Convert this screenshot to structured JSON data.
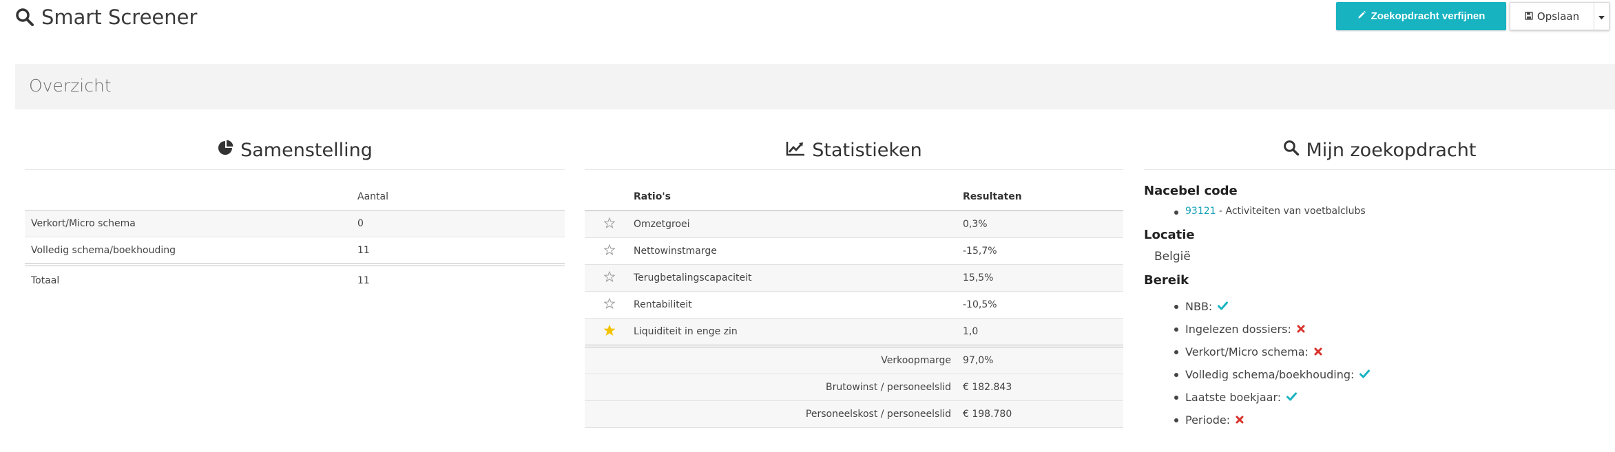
{
  "header": {
    "title": "Smart Screener",
    "refine_label": "Zoekopdracht verfijnen",
    "save_label": "Opslaan"
  },
  "overview": {
    "title": "Overzicht"
  },
  "composition": {
    "title": "Samenstelling",
    "column_header": "Aantal",
    "rows": [
      {
        "label": "Verkort/Micro schema",
        "value": "0"
      },
      {
        "label": "Volledig schema/boekhouding",
        "value": "11"
      }
    ],
    "total": {
      "label": "Totaal",
      "value": "11"
    }
  },
  "statistics": {
    "title": "Statistieken",
    "headers": {
      "ratios": "Ratio's",
      "results": "Resultaten"
    },
    "ratios": [
      {
        "label": "Omzetgroei",
        "value": "0,3%",
        "starred": false
      },
      {
        "label": "Nettowinstmarge",
        "value": "-15,7%",
        "starred": false
      },
      {
        "label": "Terugbetalingscapaciteit",
        "value": "15,5%",
        "starred": false
      },
      {
        "label": "Rentabiliteit",
        "value": "-10,5%",
        "starred": false
      },
      {
        "label": "Liquiditeit in enge zin",
        "value": "1,0",
        "starred": true
      }
    ],
    "extra": [
      {
        "label": "Verkoopmarge",
        "value": "97,0%"
      },
      {
        "label": "Brutowinst / personeelslid",
        "value": "€ 182.843"
      },
      {
        "label": "Personeelskost / personeelslid",
        "value": "€ 198.780"
      }
    ]
  },
  "search": {
    "title": "Mijn zoekopdracht",
    "nace_title": "Nacebel code",
    "nace_code": "93121",
    "nace_desc": " - Activiteiten van voetbalclubs",
    "location_title": "Locatie",
    "location_value": "België",
    "range_title": "Bereik",
    "range_items": [
      {
        "label": "NBB:",
        "ok": true
      },
      {
        "label": "Ingelezen dossiers:",
        "ok": false
      },
      {
        "label": "Verkort/Micro schema:",
        "ok": false
      },
      {
        "label": "Volledig schema/boekhouding:",
        "ok": true
      },
      {
        "label": "Laatste boekjaar:",
        "ok": true
      },
      {
        "label": "Periode:",
        "ok": false
      }
    ]
  },
  "colors": {
    "accent": "#17b3c1",
    "star_active": "#f2c200",
    "error": "#d9312b"
  },
  "icons": {
    "title": "search-icon",
    "refine": "pencil-icon",
    "save": "floppy-disk-icon",
    "caret": "caret-down-icon",
    "composition": "pie-chart-icon",
    "statistics": "line-chart-icon",
    "search": "search-icon",
    "ok": "check-icon",
    "no": "cross-icon"
  }
}
